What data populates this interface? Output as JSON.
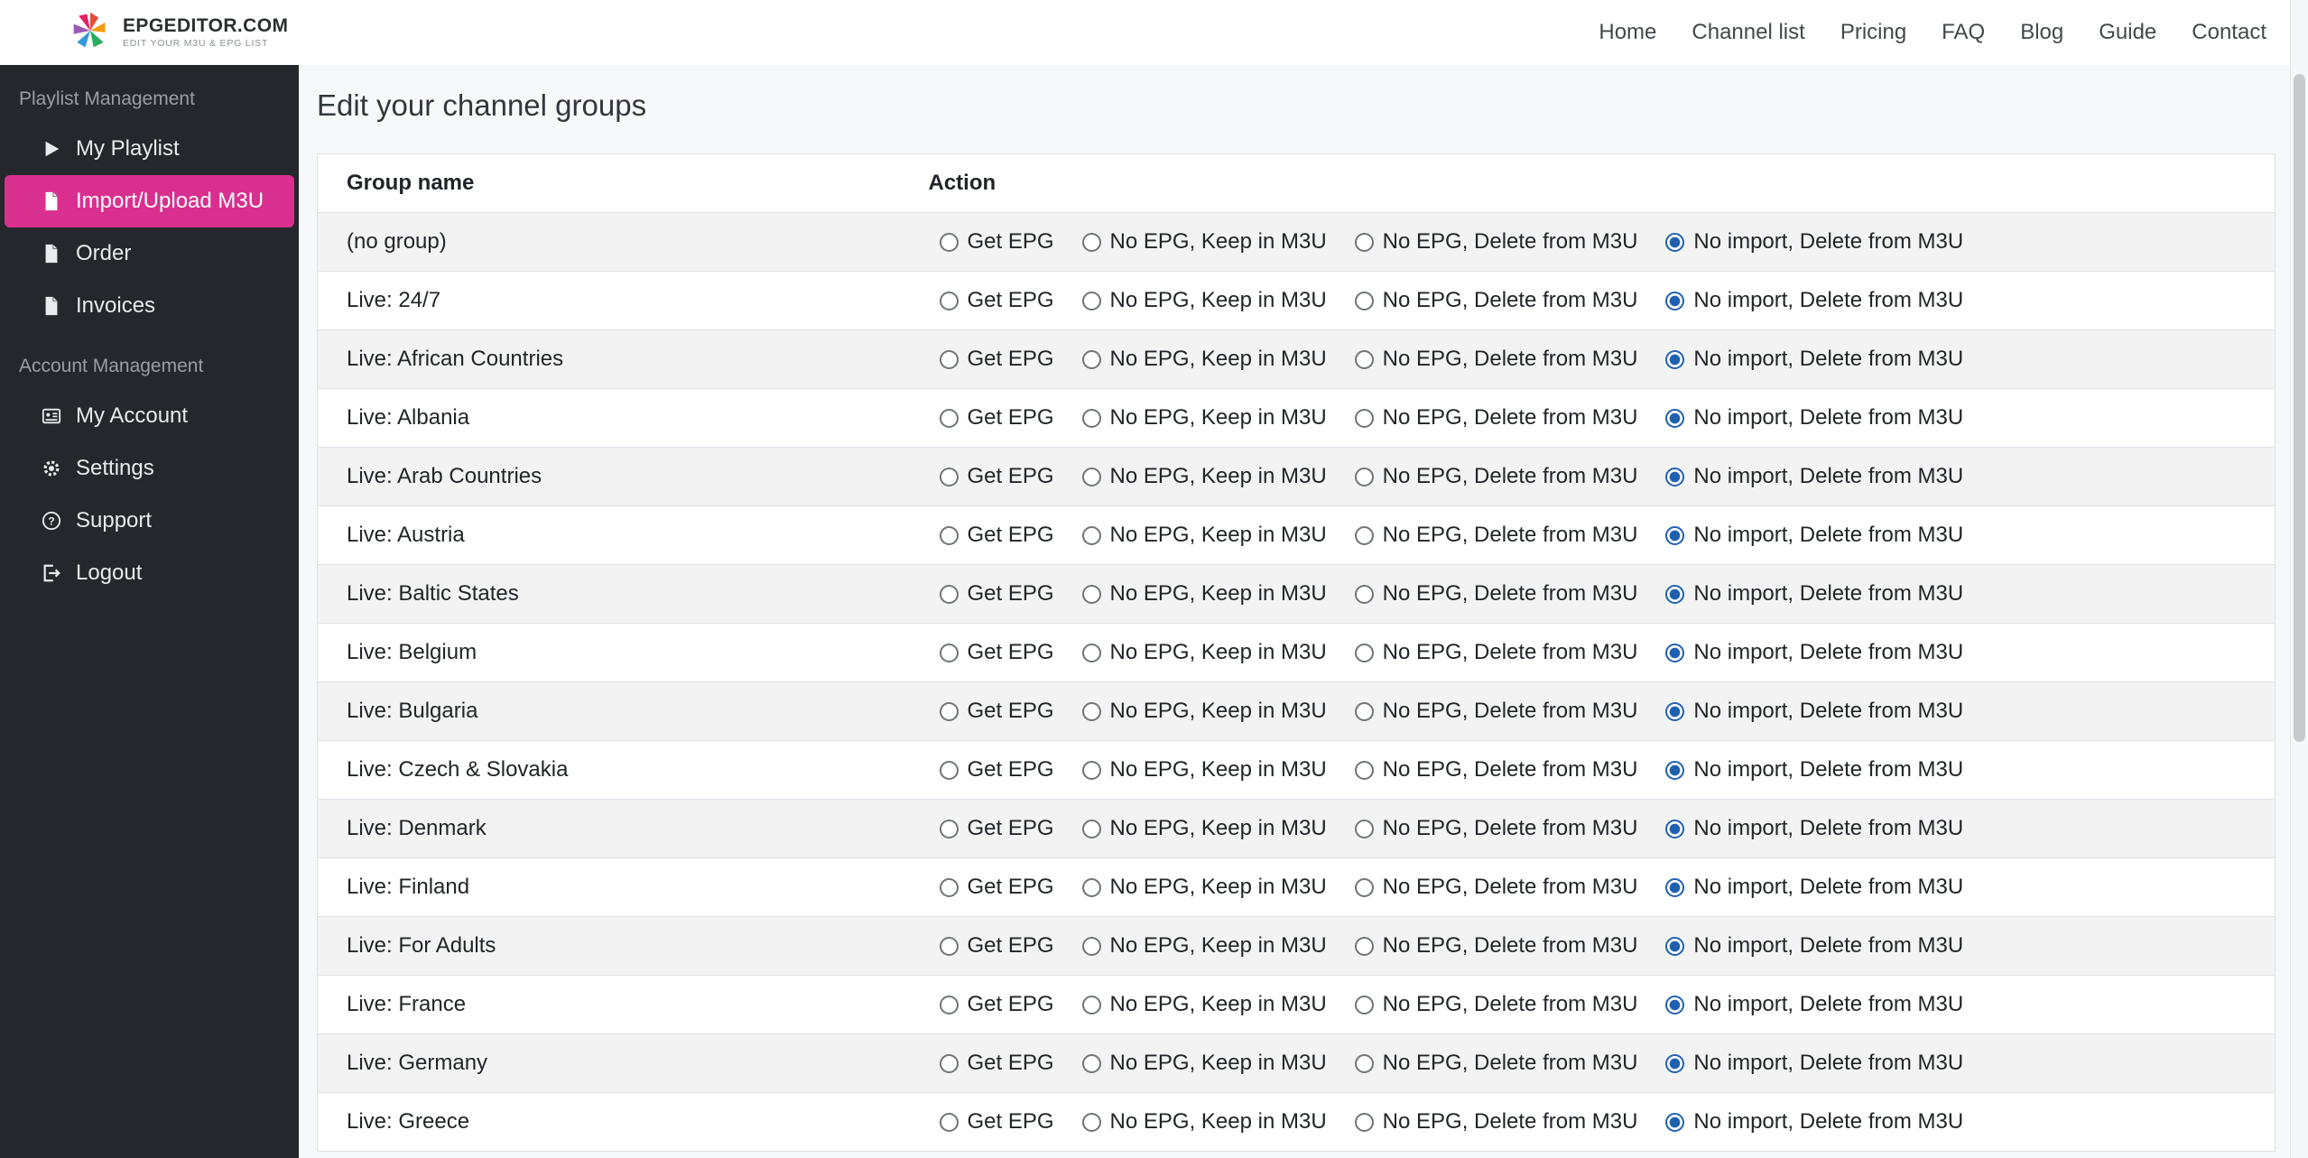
{
  "brand": {
    "name": "EPGEDITOR.COM",
    "tagline": "EDIT YOUR M3U & EPG LIST"
  },
  "topnav": {
    "items": [
      "Home",
      "Channel list",
      "Pricing",
      "FAQ",
      "Blog",
      "Guide",
      "Contact"
    ]
  },
  "sidebar": {
    "sections": [
      {
        "label": "Playlist Management",
        "items": [
          {
            "label": "My Playlist",
            "icon": "play-icon",
            "active": false
          },
          {
            "label": "Import/Upload M3U",
            "icon": "file-upload-icon",
            "active": true
          },
          {
            "label": "Order",
            "icon": "file-icon",
            "active": false
          },
          {
            "label": "Invoices",
            "icon": "file-icon",
            "active": false
          }
        ]
      },
      {
        "label": "Account Management",
        "items": [
          {
            "label": "My Account",
            "icon": "id-card-icon",
            "active": false
          },
          {
            "label": "Settings",
            "icon": "gear-icon",
            "active": false
          },
          {
            "label": "Support",
            "icon": "question-icon",
            "active": false
          },
          {
            "label": "Logout",
            "icon": "logout-icon",
            "active": false
          }
        ]
      }
    ]
  },
  "page": {
    "title": "Edit your channel groups"
  },
  "table": {
    "headers": [
      "Group name",
      "Action"
    ],
    "options": [
      "Get EPG",
      "No EPG, Keep in M3U",
      "No EPG, Delete from M3U",
      "No import, Delete from M3U"
    ],
    "selected_option_index": 3,
    "groups": [
      "(no group)",
      "Live: 24/7",
      "Live: African Countries",
      "Live: Albania",
      "Live: Arab Countries",
      "Live: Austria",
      "Live: Baltic States",
      "Live: Belgium",
      "Live: Bulgaria",
      "Live: Czech & Slovakia",
      "Live: Denmark",
      "Live: Finland",
      "Live: For Adults",
      "Live: France",
      "Live: Germany",
      "Live: Greece"
    ]
  },
  "colors": {
    "accent_pink": "#d9308f",
    "sidebar_bg": "#24272b",
    "radio_blue": "#1f61b0"
  }
}
